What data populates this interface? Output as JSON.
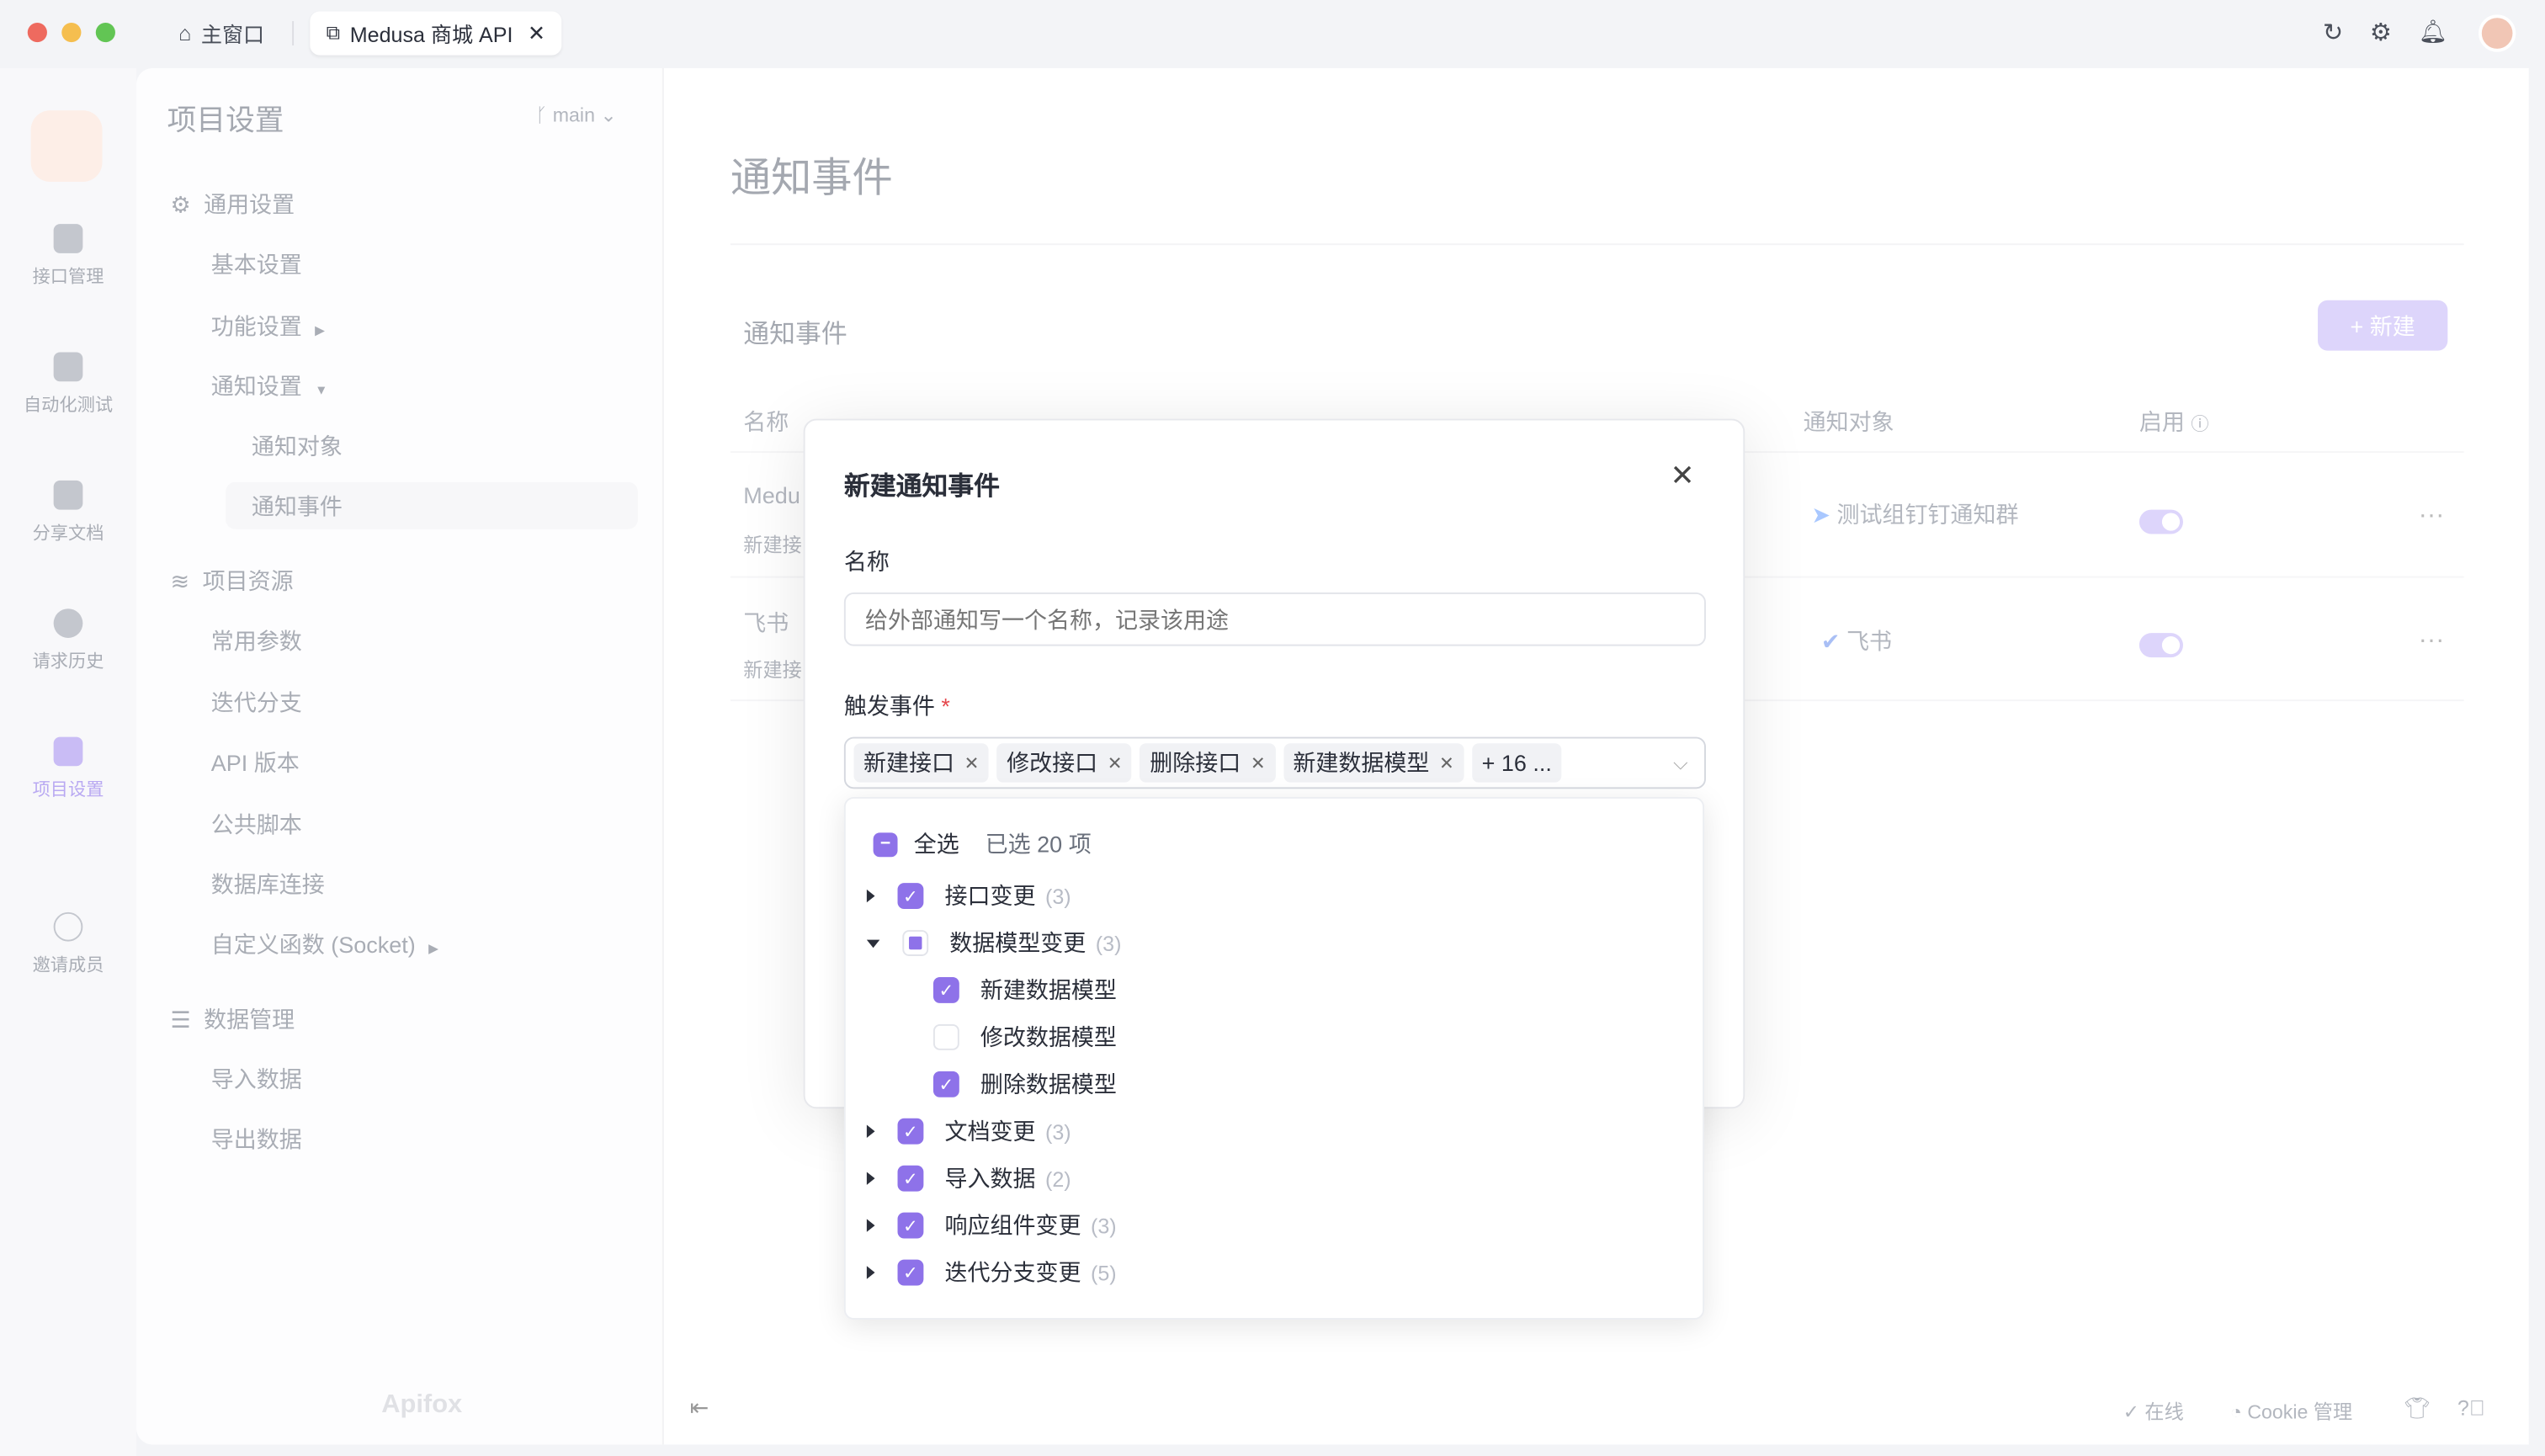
{
  "window": {
    "tabs": [
      {
        "label": "主窗口",
        "icon": "home-icon"
      },
      {
        "label": "Medusa 商城 API",
        "icon": "external-link-icon",
        "active": true
      }
    ],
    "right_icons": [
      "refresh-icon",
      "settings-icon",
      "bell-icon",
      "avatar"
    ]
  },
  "rail": {
    "items": [
      {
        "label": "接口管理"
      },
      {
        "label": "自动化测试"
      },
      {
        "label": "分享文档"
      },
      {
        "label": "请求历史"
      },
      {
        "label": "项目设置",
        "active": true
      },
      {
        "label": "邀请成员"
      }
    ]
  },
  "settings": {
    "title": "项目设置",
    "branch": "main",
    "groups": [
      {
        "label": "通用设置",
        "icon": "gear-icon",
        "items": [
          {
            "label": "基本设置"
          },
          {
            "label": "功能设置",
            "arrow": "right"
          },
          {
            "label": "通知设置",
            "arrow": "down"
          },
          {
            "label": "通知对象",
            "sub": true
          },
          {
            "label": "通知事件",
            "sub": true,
            "active": true
          }
        ]
      },
      {
        "label": "项目资源",
        "icon": "layers-icon",
        "items": [
          {
            "label": "常用参数"
          },
          {
            "label": "迭代分支"
          },
          {
            "label": "API 版本"
          },
          {
            "label": "公共脚本"
          },
          {
            "label": "数据库连接"
          },
          {
            "label": "自定义函数 (Socket)",
            "arrow": "right"
          }
        ]
      },
      {
        "label": "数据管理",
        "icon": "database-icon",
        "items": [
          {
            "label": "导入数据"
          },
          {
            "label": "导出数据"
          }
        ]
      }
    ],
    "footer_logo": "Apifox"
  },
  "main": {
    "title": "通知事件",
    "section_title": "通知事件",
    "new_button": "+ 新建",
    "columns": [
      "名称",
      "通知对象",
      "启用"
    ],
    "rows": [
      {
        "name": "Medu",
        "desc": "新建接",
        "target": "测试组钉钉通知群",
        "target_icon": "dingtalk-icon",
        "enabled": true
      },
      {
        "name": "飞书",
        "desc": "新建接",
        "target": "飞书",
        "target_icon": "feishu-icon",
        "enabled": true
      }
    ]
  },
  "footer": {
    "online": "在线",
    "cookie": "Cookie 管理"
  },
  "modal": {
    "title": "新建通知事件",
    "name_label": "名称",
    "name_placeholder": "给外部通知写一个名称，记录该用途",
    "trigger_label": "触发事件",
    "required_mark": "*",
    "tags": [
      "新建接口",
      "修改接口",
      "删除接口",
      "新建数据模型"
    ],
    "more_tag": "+ 16 ...",
    "dropdown": {
      "select_all": "全选",
      "selected_text": "已选 20 项",
      "groups": [
        {
          "label": "接口变更",
          "count": "(3)",
          "state": "checked",
          "expanded": false
        },
        {
          "label": "数据模型变更",
          "count": "(3)",
          "state": "indeterminate",
          "expanded": true,
          "children": [
            {
              "label": "新建数据模型",
              "checked": true
            },
            {
              "label": "修改数据模型",
              "checked": false
            },
            {
              "label": "删除数据模型",
              "checked": true
            }
          ]
        },
        {
          "label": "文档变更",
          "count": "(3)",
          "state": "checked",
          "expanded": false
        },
        {
          "label": "导入数据",
          "count": "(2)",
          "state": "checked",
          "expanded": false
        },
        {
          "label": "响应组件变更",
          "count": "(3)",
          "state": "checked",
          "expanded": false
        },
        {
          "label": "迭代分支变更",
          "count": "(5)",
          "state": "checked",
          "expanded": false
        }
      ]
    }
  },
  "colors": {
    "accent": "#8e72e9",
    "required": "#e5484d"
  }
}
